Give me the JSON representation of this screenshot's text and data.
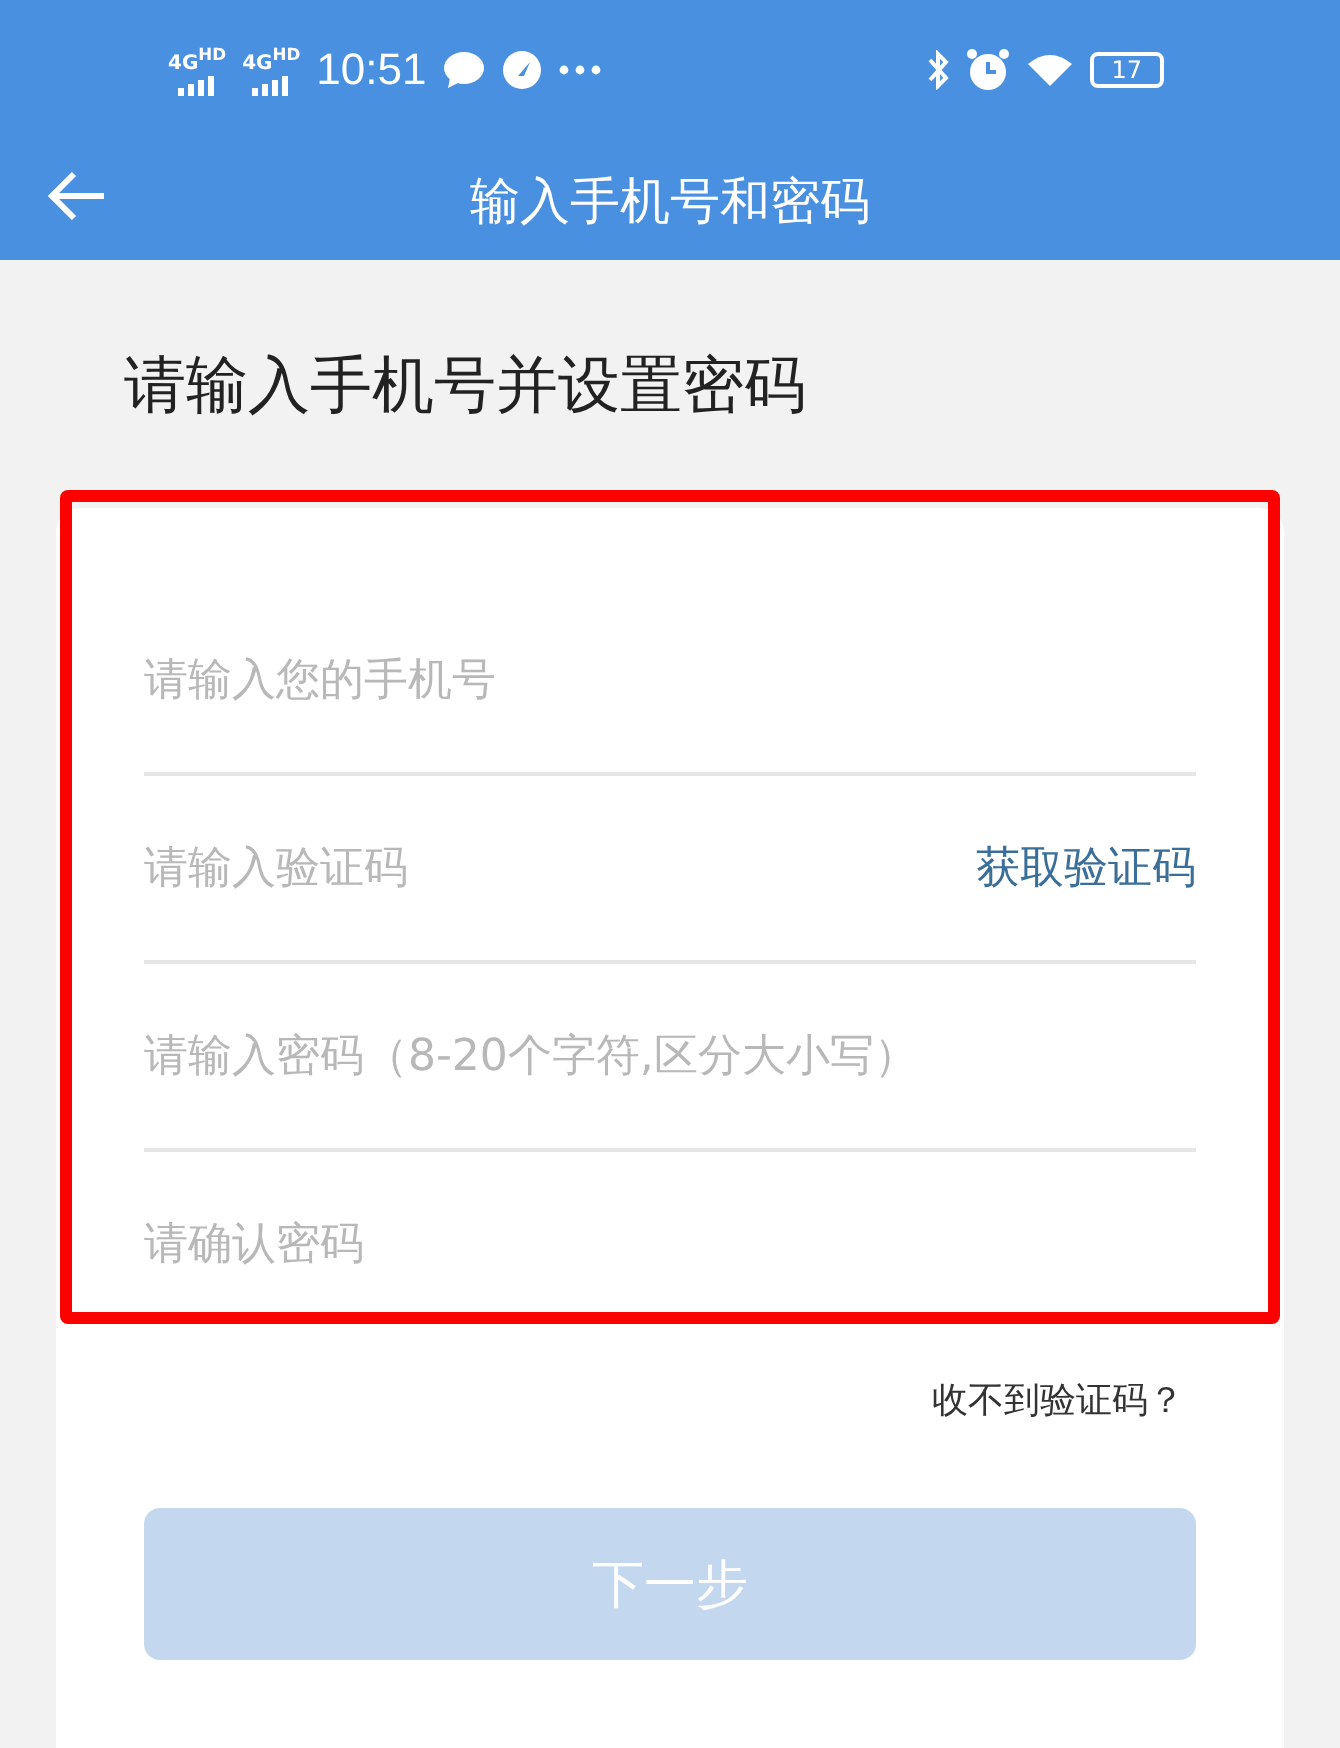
{
  "status_bar": {
    "signals": [
      "4G$^{HD}$",
      "4G$^{HD}$"
    ],
    "time": "10:51",
    "battery": "17"
  },
  "header": {
    "title": "输入手机号和密码"
  },
  "heading": "请输入手机号并设置密码",
  "fields": [
    {
      "placeholder": "请输入您的手机号"
    },
    {
      "placeholder": "请输入验证码",
      "action": "获取验证码"
    },
    {
      "placeholder": "请输入密码（8-20个字符,区分大小写）"
    },
    {
      "placeholder": "请确认密码"
    }
  ],
  "help_link": "收不到验证码？",
  "next_button": {
    "label": "下一步",
    "disabled": true
  }
}
